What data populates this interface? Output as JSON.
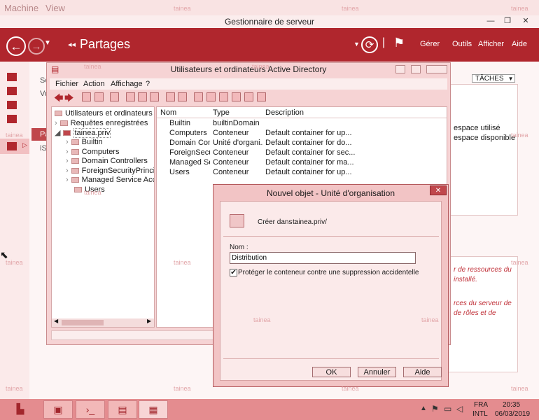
{
  "vm": {
    "menu_machine": "Machine",
    "menu_view": "View"
  },
  "server_manager": {
    "title": "Gestionnaire de serveur",
    "breadcrumb": "Partages",
    "menus": [
      "Gérer",
      "Outils",
      "Afficher",
      "Aide"
    ],
    "side_text": [
      "Se",
      "Vo",
      "Pa",
      "iS"
    ],
    "tasks_label": "TÂCHES",
    "disk_labels": [
      "espace utilisé",
      "espace disponible"
    ],
    "red_text": [
      "r de ressources du",
      "installé.",
      "rces du serveur de",
      "de rôles et de"
    ]
  },
  "ad_window": {
    "title": "Utilisateurs et ordinateurs Active Directory",
    "menu": [
      "Fichier",
      "Action",
      "Affichage",
      "?"
    ],
    "tree": {
      "root": "Utilisateurs et ordinateurs Active",
      "items": [
        {
          "label": "Requêtes enregistrées",
          "level": 1
        },
        {
          "label": "tainea.priv",
          "level": 1
        },
        {
          "label": "Builtin",
          "level": 2
        },
        {
          "label": "Computers",
          "level": 2
        },
        {
          "label": "Domain Controllers",
          "level": 2
        },
        {
          "label": "ForeignSecurityPrincipals",
          "level": 2
        },
        {
          "label": "Managed Service Accour",
          "level": 2
        },
        {
          "label": "Users",
          "level": 2
        }
      ]
    },
    "columns": [
      "Nom",
      "Type",
      "Description"
    ],
    "rows": [
      {
        "name": "Builtin",
        "type": "builtinDomain",
        "desc": ""
      },
      {
        "name": "Computers",
        "type": "Conteneur",
        "desc": "Default container for up..."
      },
      {
        "name": "Domain Con...",
        "type": "Unité d'organi...",
        "desc": "Default container for do..."
      },
      {
        "name": "ForeignSecu...",
        "type": "Conteneur",
        "desc": "Default container for sec..."
      },
      {
        "name": "Managed Se...",
        "type": "Conteneur",
        "desc": "Default container for ma..."
      },
      {
        "name": "Users",
        "type": "Conteneur",
        "desc": "Default container for up..."
      }
    ]
  },
  "dialog": {
    "title": "Nouvel objet - Unité d'organisation",
    "create_in_label": "Créer dans :",
    "create_in_value": "tainea.priv/",
    "name_label": "Nom :",
    "name_value": "Distribution",
    "protect_label": "Protéger le conteneur contre une suppression accidentelle",
    "protect_checked": true,
    "ok": "OK",
    "cancel": "Annuler",
    "help": "Aide"
  },
  "taskbar": {
    "lang": "FRA",
    "layout": "INTL",
    "time": "20:35",
    "date": "06/03/2019"
  },
  "watermark": "tainea",
  "colors": {
    "accent": "#b0262d",
    "taskbar": "#e48c8f"
  }
}
